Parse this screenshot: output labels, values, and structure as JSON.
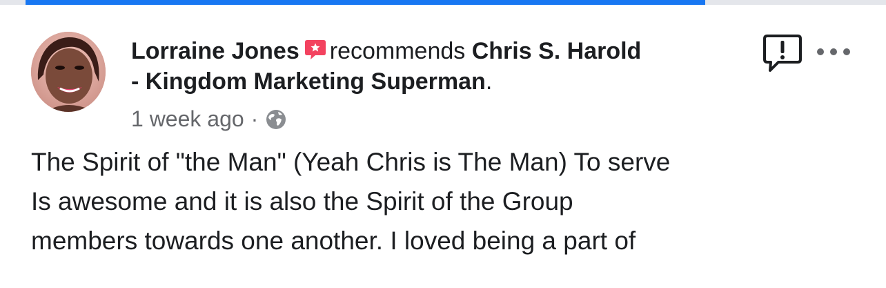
{
  "progress": {
    "fill_fraction": 0.79,
    "color": "#1877f2"
  },
  "post": {
    "author": "Lorraine Jones",
    "verb": "recommends",
    "target_line1": "Chris S. Harold",
    "target_line2": "- Kingdom Marketing Superman",
    "target_period": ".",
    "timestamp": "1 week ago",
    "separator": "·",
    "privacy_icon": "globe-icon",
    "recommend_icon": "recommend-badge-icon",
    "accent_red": "#f3425f",
    "body_lines": [
      "The Spirit of \"the Man\" (Yeah Chris is The Man) To serve",
      "Is awesome and it is also the Spirit of the Group",
      "members towards one another. I loved being a part of"
    ]
  },
  "actions": {
    "report_icon": "report-icon",
    "more_icon": "more-options-icon"
  }
}
